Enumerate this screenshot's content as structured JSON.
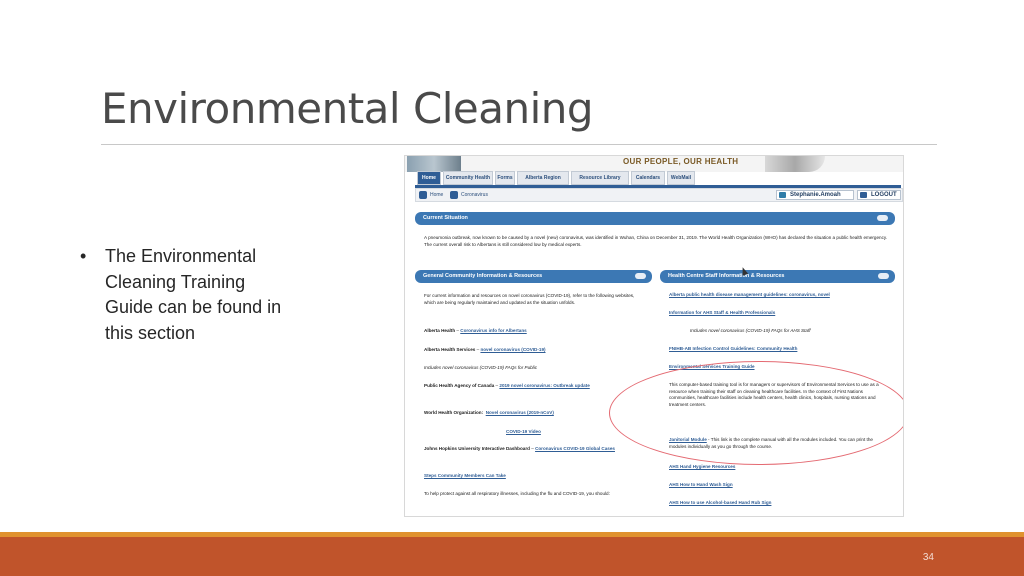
{
  "slide": {
    "title": "Environmental Cleaning",
    "bullet_dot": "•",
    "bullet": "The Environmental Cleaning Training Guide can be found in this section",
    "page_number": "34"
  },
  "site": {
    "banner_text": "OUR PEOPLE, OUR HEALTH",
    "tabs": [
      "Home",
      "Community Health",
      "Forms",
      "Alberta Region",
      "Resource Library",
      "Calendars",
      "WebMail"
    ],
    "breadcrumb": [
      "Home",
      "Coronavirus"
    ],
    "user": "Stephanie.Amoah",
    "logout": "LOGOUT",
    "current_situation": {
      "header": "Current Situation",
      "text": "A pneumonia outbreak, now known to be caused by a novel (new) coronavirus, was identified in Wuhan, China on December 31, 2019. The World Health Organization (WHO) has declared the situation a public health emergency. The current overall risk to Albertans is still considered low by medical experts."
    },
    "general": {
      "header": "General Community Information & Resources",
      "intro": "For current information and resources on novel coronavirus (COVID-19), refer to the following websites, which are being regularly maintained and updated as the situation unfolds.",
      "ah_label": "Alberta Health",
      "ah_sep": " – ",
      "ah_link": "Coronavirus info for Albertans",
      "ahs_label": "Alberta Health Services",
      "ahs_sep": " – ",
      "ahs_link": "novel coronavirus (COVID-19)",
      "ahs_note": "Includes novel coronavirus (COVID-19) FAQs for Public",
      "phac_label": "Public Health Agency of Canada",
      "phac_sep": " – ",
      "phac_link": "2019 novel coronavirus: Outbreak update",
      "who_label": "World Health Organization:",
      "who_link": "Novel coronavirus (2019-nCoV)",
      "video_link": "COVID-19 Video",
      "jh_label": "Johns Hopkins University Interactive Dashboard",
      "jh_sep": " – ",
      "jh_link": "Coronavirus COVID-19 Global Cases",
      "steps_link": "Steps Community Members Can Take",
      "protect": "To help protect against all respiratory illnesses, including the flu and COVID-19, you should:"
    },
    "staff": {
      "header": "Health Centre Staff Information & Resources",
      "link1": "Alberta public health disease management guidelines: coronavirus, novel",
      "link2": "Information for AHS Staff & Health Professionals",
      "note2": "Includes novel coronavirus (COVID-19) FAQs for AHS Staff",
      "link3": "FNIHB-AB Infection Control Guidelines: Community Health",
      "link4": "Environmental Services Training Guide",
      "desc4": "This computer-based training tool is for managers or supervisors of Environmental Services to use as a resource when training their staff on cleaning healthcare facilities. In the context of First Nations communities, healthcare facilities include health centers, health clinics, hospitals, nursing stations and treatment centers.",
      "link5": "Janitorial Module",
      "desc5": " - This link is the complete manual with all the modules included. You can print the modules individually as you go through the course.",
      "link6": "AHS Hand Hygiene Resources",
      "link7": "AHS How to Hand Wash Sign",
      "link8": "AHS How to use Alcohol-based Hand Rub Sign"
    }
  },
  "colors": {
    "accent_blue": "#3c78b4",
    "footer_orange": "#c0542b",
    "footer_line": "#e0922f",
    "highlight_circle": "#e46a72"
  }
}
